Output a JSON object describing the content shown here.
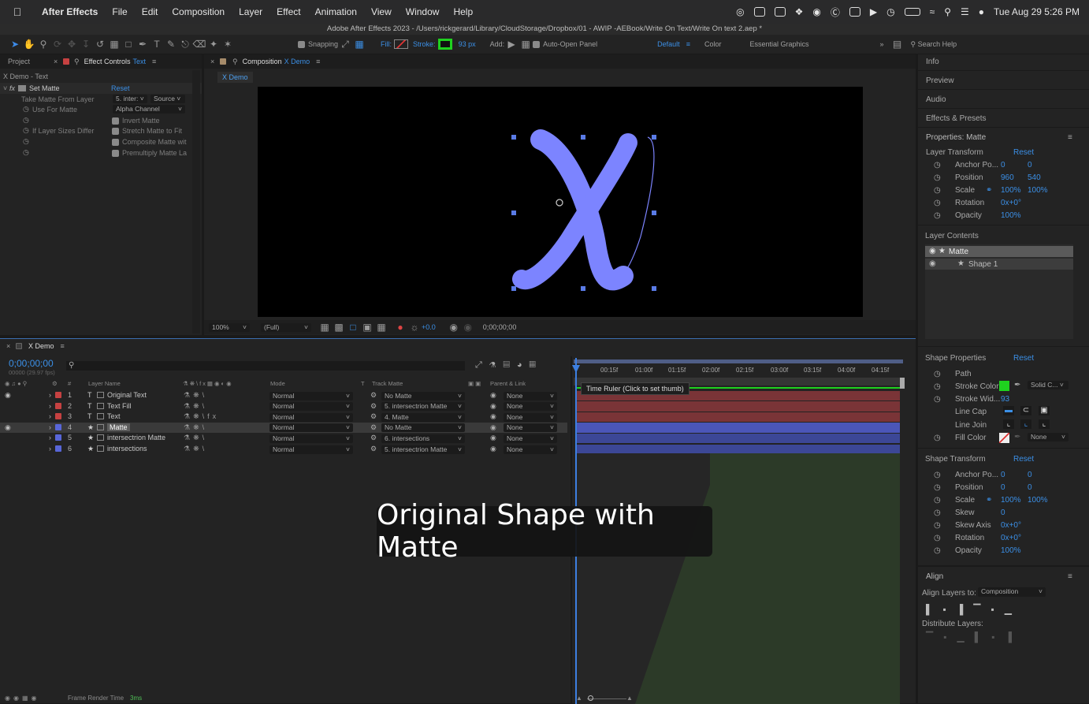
{
  "menubar": {
    "app": "After Effects",
    "items": [
      "File",
      "Edit",
      "Composition",
      "Layer",
      "Effect",
      "Animation",
      "View",
      "Window",
      "Help"
    ],
    "clock": "Tue Aug 29  5:26 PM"
  },
  "window_title": "Adobe After Effects 2023 - /Users/rickgerard/Library/CloudStorage/Dropbox/01 - AWIP -AEBook/Write On Text/Write On text 2.aep *",
  "toolbar": {
    "snapping": "Snapping",
    "fill": "Fill:",
    "stroke": "Stroke:",
    "stroke_px": "93 px",
    "add": "Add:",
    "auto_open": "Auto-Open Panel",
    "workspace_default": "Default",
    "workspace_color": "Color",
    "workspace_essential": "Essential Graphics",
    "search_help": "Search Help",
    "stroke_color": "#1fd11f"
  },
  "effect_panel": {
    "tab_project": "Project",
    "tab_effect_controls": "Effect Controls",
    "tab_effect_target": "Text",
    "breadcrumb": "X Demo - Text",
    "effect_name": "Set Matte",
    "reset": "Reset",
    "rows": [
      {
        "label": "Take Matte From Layer",
        "value": "5. inter:",
        "value2": "Source"
      },
      {
        "label": "Use For Matte",
        "value": "Alpha Channel"
      },
      {
        "label": "",
        "checkbox": "Invert Matte"
      },
      {
        "label": "If Layer Sizes Differ",
        "checkbox": "Stretch Matte to Fit"
      },
      {
        "label": "",
        "checkbox": "Composite Matte wit"
      },
      {
        "label": "",
        "checkbox": "Premultiply Matte La"
      }
    ]
  },
  "comp_panel": {
    "tab_prefix": "Composition",
    "tab_name": "X Demo",
    "sub_tab": "X Demo",
    "zoom": "100%",
    "resolution": "(Full)",
    "exposure": "+0.0",
    "timecode": "0;00;00;00"
  },
  "right_panel": {
    "tabs": [
      "Info",
      "Preview",
      "Audio",
      "Effects & Presets"
    ],
    "properties_title": "Properties: Matte",
    "layer_transform": "Layer Transform",
    "reset": "Reset",
    "transform_rows": [
      {
        "label": "Anchor Po...",
        "v1": "0",
        "v2": "0"
      },
      {
        "label": "Position",
        "v1": "960",
        "v2": "540"
      },
      {
        "label": "Scale",
        "v1": "100%",
        "v2": "100%"
      },
      {
        "label": "Rotation",
        "v1": "0x+0°",
        "v2": ""
      },
      {
        "label": "Opacity",
        "v1": "100%",
        "v2": ""
      }
    ],
    "layer_contents": "Layer Contents",
    "contents": [
      "Matte",
      "Shape 1"
    ],
    "shape_properties": "Shape Properties",
    "shape_rows": [
      {
        "label": "Path",
        "v1": ""
      },
      {
        "label": "Stroke Color",
        "v1": "Solid C..."
      },
      {
        "label": "Stroke Wid...",
        "v1": "93"
      },
      {
        "label": "Line Cap",
        "v1": ""
      },
      {
        "label": "Line Join",
        "v1": ""
      },
      {
        "label": "Fill Color",
        "v1": "None"
      }
    ],
    "shape_transform": "Shape Transform",
    "shape_transform_rows": [
      {
        "label": "Anchor Po...",
        "v1": "0",
        "v2": "0"
      },
      {
        "label": "Position",
        "v1": "0",
        "v2": "0"
      },
      {
        "label": "Scale",
        "v1": "100%",
        "v2": "100%"
      },
      {
        "label": "Skew",
        "v1": "0",
        "v2": ""
      },
      {
        "label": "Skew Axis",
        "v1": "0x+0°",
        "v2": ""
      },
      {
        "label": "Rotation",
        "v1": "0x+0°",
        "v2": ""
      },
      {
        "label": "Opacity",
        "v1": "100%",
        "v2": ""
      }
    ],
    "align": "Align",
    "align_layers_to": "Align Layers to:",
    "align_target": "Composition",
    "distribute": "Distribute Layers:"
  },
  "timeline": {
    "tab": "X Demo",
    "timecode": "0;00;00;00",
    "fps": "00000 (29.97 fps)",
    "col_layer_name": "Layer Name",
    "col_mode": "Mode",
    "col_t": "T",
    "col_track_matte": "Track Matte",
    "col_parent": "Parent & Link",
    "ruler": [
      "00:15f",
      "01:00f",
      "01:15f",
      "02:00f",
      "02:15f",
      "03:00f",
      "03:15f",
      "04:00f",
      "04:15f"
    ],
    "tooltip": "Time Ruler (Click to set thumb)",
    "layers": [
      {
        "num": "1",
        "type": "T",
        "name": "Original Text",
        "color": "#c64141",
        "mode": "Normal",
        "matte": "No Matte",
        "parent": "None",
        "bar": "#7a3437",
        "eye": true
      },
      {
        "num": "2",
        "type": "T",
        "name": "Text Fill",
        "color": "#c64141",
        "mode": "Normal",
        "matte": "5. intersectrion Matte",
        "parent": "None",
        "bar": "#7a3437",
        "eye": false
      },
      {
        "num": "3",
        "type": "T",
        "name": "Text",
        "color": "#c64141",
        "mode": "Normal",
        "matte": "4. Matte",
        "parent": "None",
        "bar": "#7a3437",
        "eye": false
      },
      {
        "num": "4",
        "type": "★",
        "name": "Matte",
        "color": "#5866d8",
        "mode": "Normal",
        "matte": "No Matte",
        "parent": "None",
        "bar": "#4b56b8",
        "eye": true
      },
      {
        "num": "5",
        "type": "★",
        "name": "intersectrion Matte",
        "color": "#5866d8",
        "mode": "Normal",
        "matte": "6. intersections",
        "parent": "None",
        "bar": "#3c4796",
        "eye": false
      },
      {
        "num": "6",
        "type": "★",
        "name": "intersections",
        "color": "#5866d8",
        "mode": "Normal",
        "matte": "5. intersectrion Matte",
        "parent": "None",
        "bar": "#3c4796",
        "eye": false
      }
    ],
    "frame_render_label": "Frame Render Time",
    "frame_render_value": "3ms"
  },
  "overlay_caption": "Original Shape with Matte"
}
